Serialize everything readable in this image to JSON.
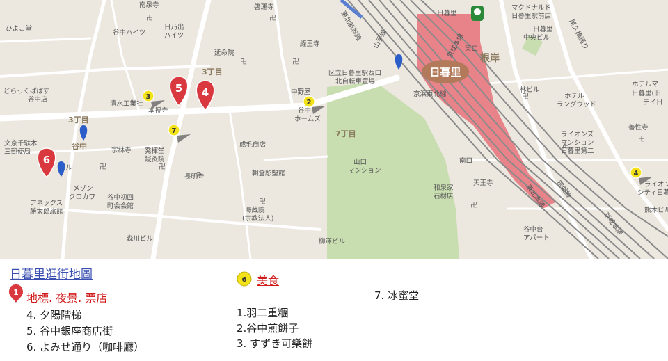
{
  "map": {
    "labels": [
      {
        "id": "nanryoji",
        "text": "南泉寺"
      },
      {
        "id": "keiunji",
        "text": "啓運寺"
      },
      {
        "id": "hiyokodo",
        "text": "ひよこ堂"
      },
      {
        "id": "yanaka_heights",
        "text": "谷中ハイツ"
      },
      {
        "id": "hinode_heights1",
        "text": "日乃出"
      },
      {
        "id": "hinode_heights2",
        "text": "ハイツ"
      },
      {
        "id": "enmeiin",
        "text": "延命院"
      },
      {
        "id": "kyooji",
        "text": "経王寺"
      },
      {
        "id": "sannomyo",
        "text": "3丁目"
      },
      {
        "id": "dorakuba1",
        "text": "どらっくぱぱす"
      },
      {
        "id": "dorakuba2",
        "text": "谷中店"
      },
      {
        "id": "shimizu",
        "text": "清水工業社"
      },
      {
        "id": "honjuji",
        "text": "本授寺"
      },
      {
        "id": "nakanoya",
        "text": "中野屋"
      },
      {
        "id": "yanaka_homes",
        "text": "谷中"
      },
      {
        "id": "homes2",
        "text": "ホームズ"
      },
      {
        "id": "sannomyo2",
        "text": "3丁目"
      },
      {
        "id": "yanaka_area",
        "text": "谷中"
      },
      {
        "id": "nanachome",
        "text": "7丁目"
      },
      {
        "id": "bunkyo1",
        "text": "文京千駄木"
      },
      {
        "id": "bunkyo2",
        "text": "三郵便局"
      },
      {
        "id": "sourinji",
        "text": "宗林寺"
      },
      {
        "id": "hakkendo1",
        "text": "発揮堂"
      },
      {
        "id": "hakkendo2",
        "text": "鍼灸院"
      },
      {
        "id": "naruke",
        "text": "成毛商店"
      },
      {
        "id": "asakura",
        "text": "朝倉彫塑館"
      },
      {
        "id": "yamaguchi1",
        "text": "山口"
      },
      {
        "id": "yamaguchi2",
        "text": "マンション"
      },
      {
        "id": "biru",
        "text": "ビル"
      },
      {
        "id": "chomeiji",
        "text": "長明寺"
      },
      {
        "id": "maison1",
        "text": "メゾン"
      },
      {
        "id": "maison2",
        "text": "クロカワ"
      },
      {
        "id": "chokai1",
        "text": "谷中初四"
      },
      {
        "id": "chokai2",
        "text": "町会会館"
      },
      {
        "id": "annex1",
        "text": "アネックス"
      },
      {
        "id": "annex2",
        "text": "勝太郎旅館"
      },
      {
        "id": "kaizoin1",
        "text": "海蔵院"
      },
      {
        "id": "kaizoin2",
        "text": "(宗教法人)"
      },
      {
        "id": "morikawa",
        "text": "森川ビル"
      },
      {
        "id": "yanagisawa",
        "text": "柳澤ビル"
      },
      {
        "id": "station_west1",
        "text": "区立日暮里駅西口"
      },
      {
        "id": "station_west2",
        "text": "北自転車置場"
      },
      {
        "id": "yamanote",
        "text": "山手線"
      },
      {
        "id": "keisei",
        "text": "京成本線"
      },
      {
        "id": "keihin",
        "text": "京浜東北線"
      },
      {
        "id": "higashiguchi",
        "text": "東口"
      },
      {
        "id": "negishi",
        "text": "根岸"
      },
      {
        "id": "nippori_top",
        "text": "日暮里"
      },
      {
        "id": "mcd1",
        "text": "マクドナルド"
      },
      {
        "id": "mcd2",
        "text": "日暮里駅前店"
      },
      {
        "id": "nippori_chuo1",
        "text": "日暮里"
      },
      {
        "id": "nippori_chuo2",
        "text": "中央ビル"
      },
      {
        "id": "hayashi",
        "text": "林ビル"
      },
      {
        "id": "hotel_lg1",
        "text": "ホテル"
      },
      {
        "id": "hotel_lg2",
        "text": "ラングウッド"
      },
      {
        "id": "hotel_nippori1",
        "text": "ホテルマ"
      },
      {
        "id": "hotel_nippori2",
        "text": "日暮里(旧"
      },
      {
        "id": "hotel_nippori3",
        "text": "テイ日"
      },
      {
        "id": "zenseiji",
        "text": "善性寺"
      },
      {
        "id": "lions1",
        "text": "ライオンズ"
      },
      {
        "id": "lions2",
        "text": "マンション"
      },
      {
        "id": "lions3",
        "text": "日暮里第二"
      },
      {
        "id": "joban",
        "text": "常磐線"
      },
      {
        "id": "tohoku",
        "text": "東北本線"
      },
      {
        "id": "minamiguchi",
        "text": "南口"
      },
      {
        "id": "wasen1",
        "text": "和泉家"
      },
      {
        "id": "wasen2",
        "text": "石材店"
      },
      {
        "id": "tennoji",
        "text": "天王寺"
      },
      {
        "id": "yanakadai1",
        "text": "谷中台"
      },
      {
        "id": "yanakadai2",
        "text": "アパート"
      },
      {
        "id": "keisei2",
        "text": "京成本線"
      },
      {
        "id": "lions_city1",
        "text": "ライオンズ"
      },
      {
        "id": "lions_city2",
        "text": "シティ日暮里"
      },
      {
        "id": "kumaki",
        "text": "熊木ビル"
      },
      {
        "id": "otakebashi",
        "text": "尾久橋通り"
      },
      {
        "id": "shinkansen",
        "text": "東北新幹線"
      },
      {
        "id": "ni_kanji",
        "text": "日暮里"
      }
    ],
    "station_badge": "日暮里",
    "pins": {
      "red": [
        {
          "id": "pin4",
          "num": "4"
        },
        {
          "id": "pin5",
          "num": "5"
        },
        {
          "id": "pin6",
          "num": "6"
        }
      ],
      "yellow": [
        {
          "id": "ypin2",
          "num": "2"
        },
        {
          "id": "ypin3",
          "num": "3"
        },
        {
          "id": "ypin4",
          "num": "4"
        },
        {
          "id": "ypin7",
          "num": "7"
        }
      ]
    },
    "colors": {
      "land": "#ece7df",
      "road": "#ffffff",
      "park": "#c8ddb0",
      "station": "#e9838a",
      "rail": "#8a8a8a",
      "red_pin": "#d9383e",
      "yellow_pin": "#f3e21a",
      "blue_pin": "#2b5ec9"
    }
  },
  "legend": {
    "title": "日暮里逛街地圖",
    "landmarks_badge": "1",
    "landmarks_label": "地標. 夜景. 票店",
    "landmark_items": [
      "4. 夕陽階梯",
      "5. 谷中銀座商店街",
      "6. よみせ通り（咖啡廳）"
    ],
    "food_badge": "6",
    "food_label": "美食",
    "food_items": [
      "1.羽二重糰",
      "2.谷中煎餅子",
      "3. すずき可樂餅"
    ],
    "extra_items": [
      "7. 冰蜜堂"
    ]
  }
}
